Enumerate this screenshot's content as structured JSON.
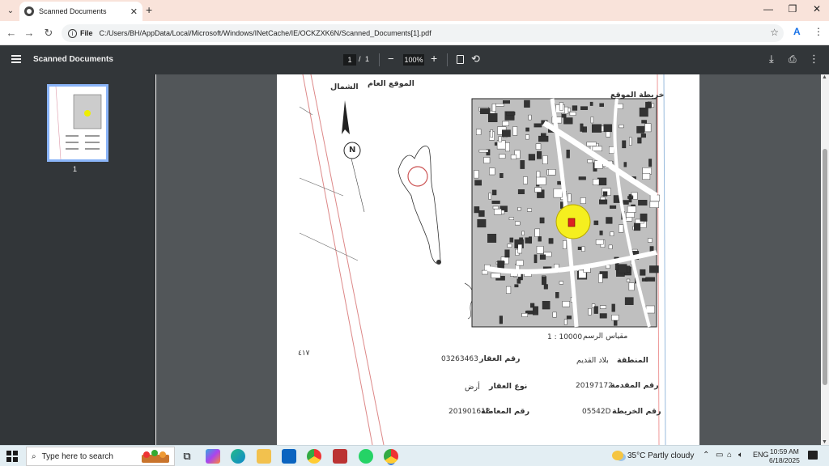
{
  "browser": {
    "tab_title": "Scanned Documents",
    "new_tab_label": "+",
    "address_scheme": "File",
    "url": "C:/Users/BH/AppData/Local/Microsoft/Windows/INetCache/IE/OCKZXK6N/Scanned_Documents[1].pdf"
  },
  "pdf_toolbar": {
    "title": "Scanned Documents",
    "current_page": "1",
    "page_separator": "/",
    "total_pages": "1",
    "zoom": "100%"
  },
  "sidebar": {
    "thumbnail_label": "1"
  },
  "document": {
    "map_title": "خريطة الموقع",
    "general_location": "الموقع العام",
    "north_label": "الشمال",
    "north_letter": "N",
    "scale_label": "مقياس الرسم",
    "scale_value": "1 : 10000",
    "page_mark": "٤١٧",
    "fields": [
      {
        "label": "المنطقة",
        "value": "بلاد القديم"
      },
      {
        "label": "رقم العقار",
        "value": "03263463"
      },
      {
        "label": "رقم المقدمة",
        "value": "20197172"
      },
      {
        "label": "نوع العقار",
        "value": "أرض"
      },
      {
        "label": "رقم الخريطة",
        "value": "05542D"
      },
      {
        "label": "رقم المعاملة",
        "value": "201901618"
      }
    ]
  },
  "taskbar": {
    "search_placeholder": "Type here to search",
    "weather": "35°C  Partly cloudy",
    "language": "ENG",
    "time": "10:59 AM",
    "date": "6/18/2025"
  }
}
